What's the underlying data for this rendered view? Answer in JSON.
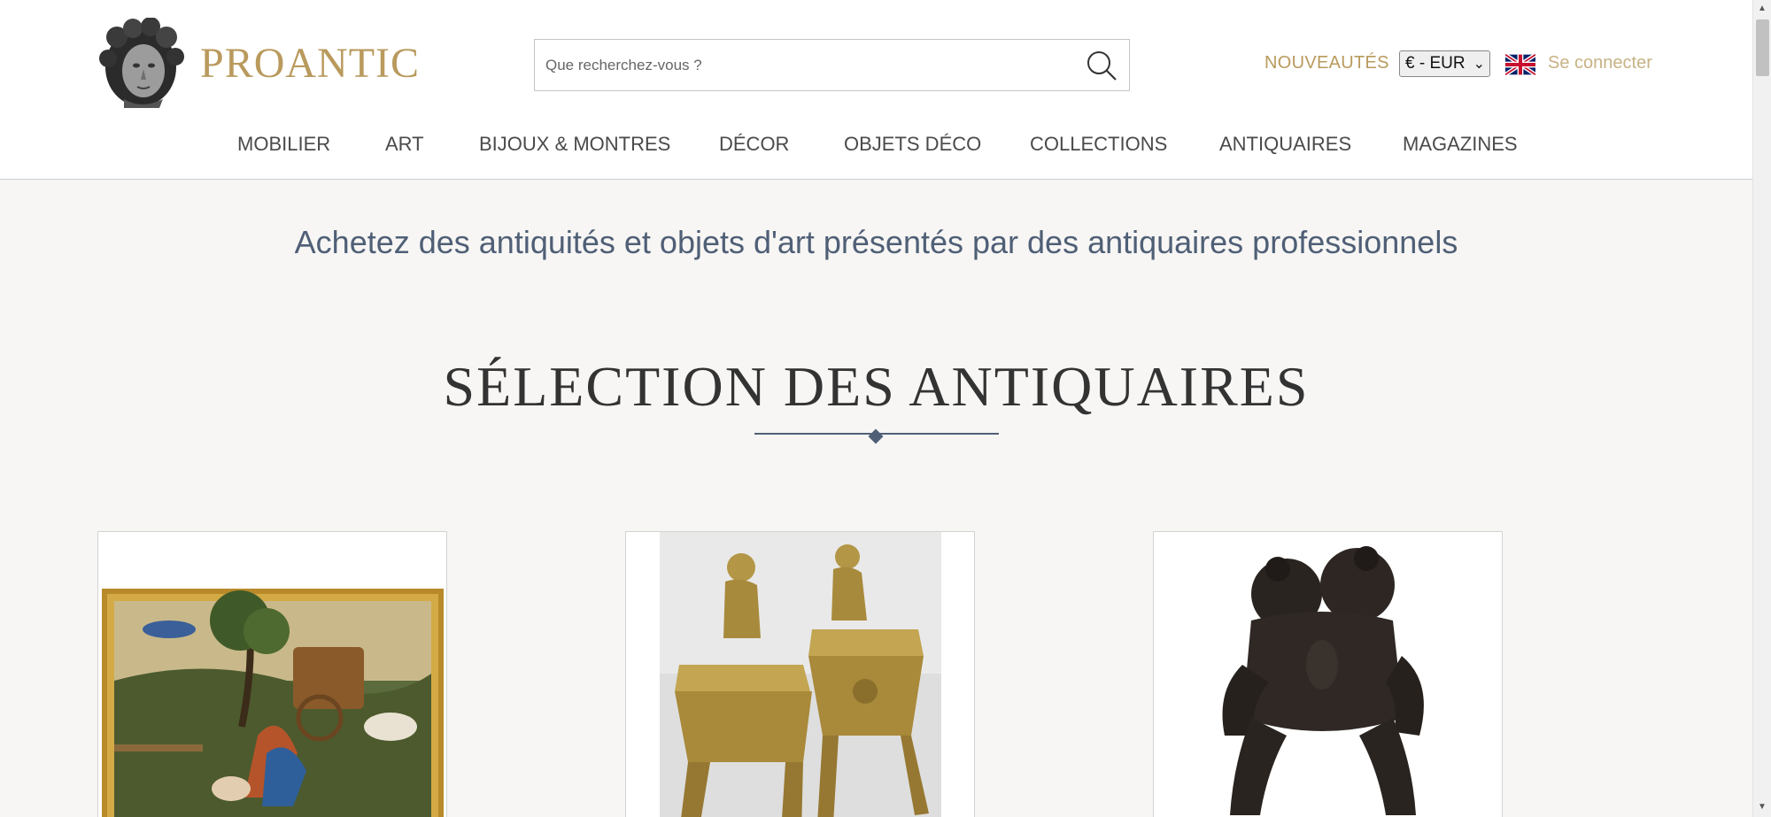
{
  "brand": {
    "name": "PROANTIC"
  },
  "search": {
    "placeholder": "Que recherchez-vous ?"
  },
  "header": {
    "new_label": "NOUVEAUTÉS",
    "currency": "€ - EUR",
    "language_icon": "uk-flag-icon",
    "login_label": "Se connecter"
  },
  "nav": {
    "items": [
      {
        "label": "MOBILIER"
      },
      {
        "label": "ART"
      },
      {
        "label": "BIJOUX & MONTRES"
      },
      {
        "label": "DÉCOR"
      },
      {
        "label": "OBJETS DÉCO"
      },
      {
        "label": "COLLECTIONS"
      },
      {
        "label": "ANTIQUAIRES"
      },
      {
        "label": "MAGAZINES"
      }
    ]
  },
  "main": {
    "tagline": "Achetez des antiquités et objets d'art présentés par des antiquaires professionnels",
    "section_title": "SÉLECTION DES ANTIQUAIRES"
  },
  "colors": {
    "gold": "#b99a5d",
    "slate": "#4f5f76",
    "background": "#f7f6f4"
  }
}
